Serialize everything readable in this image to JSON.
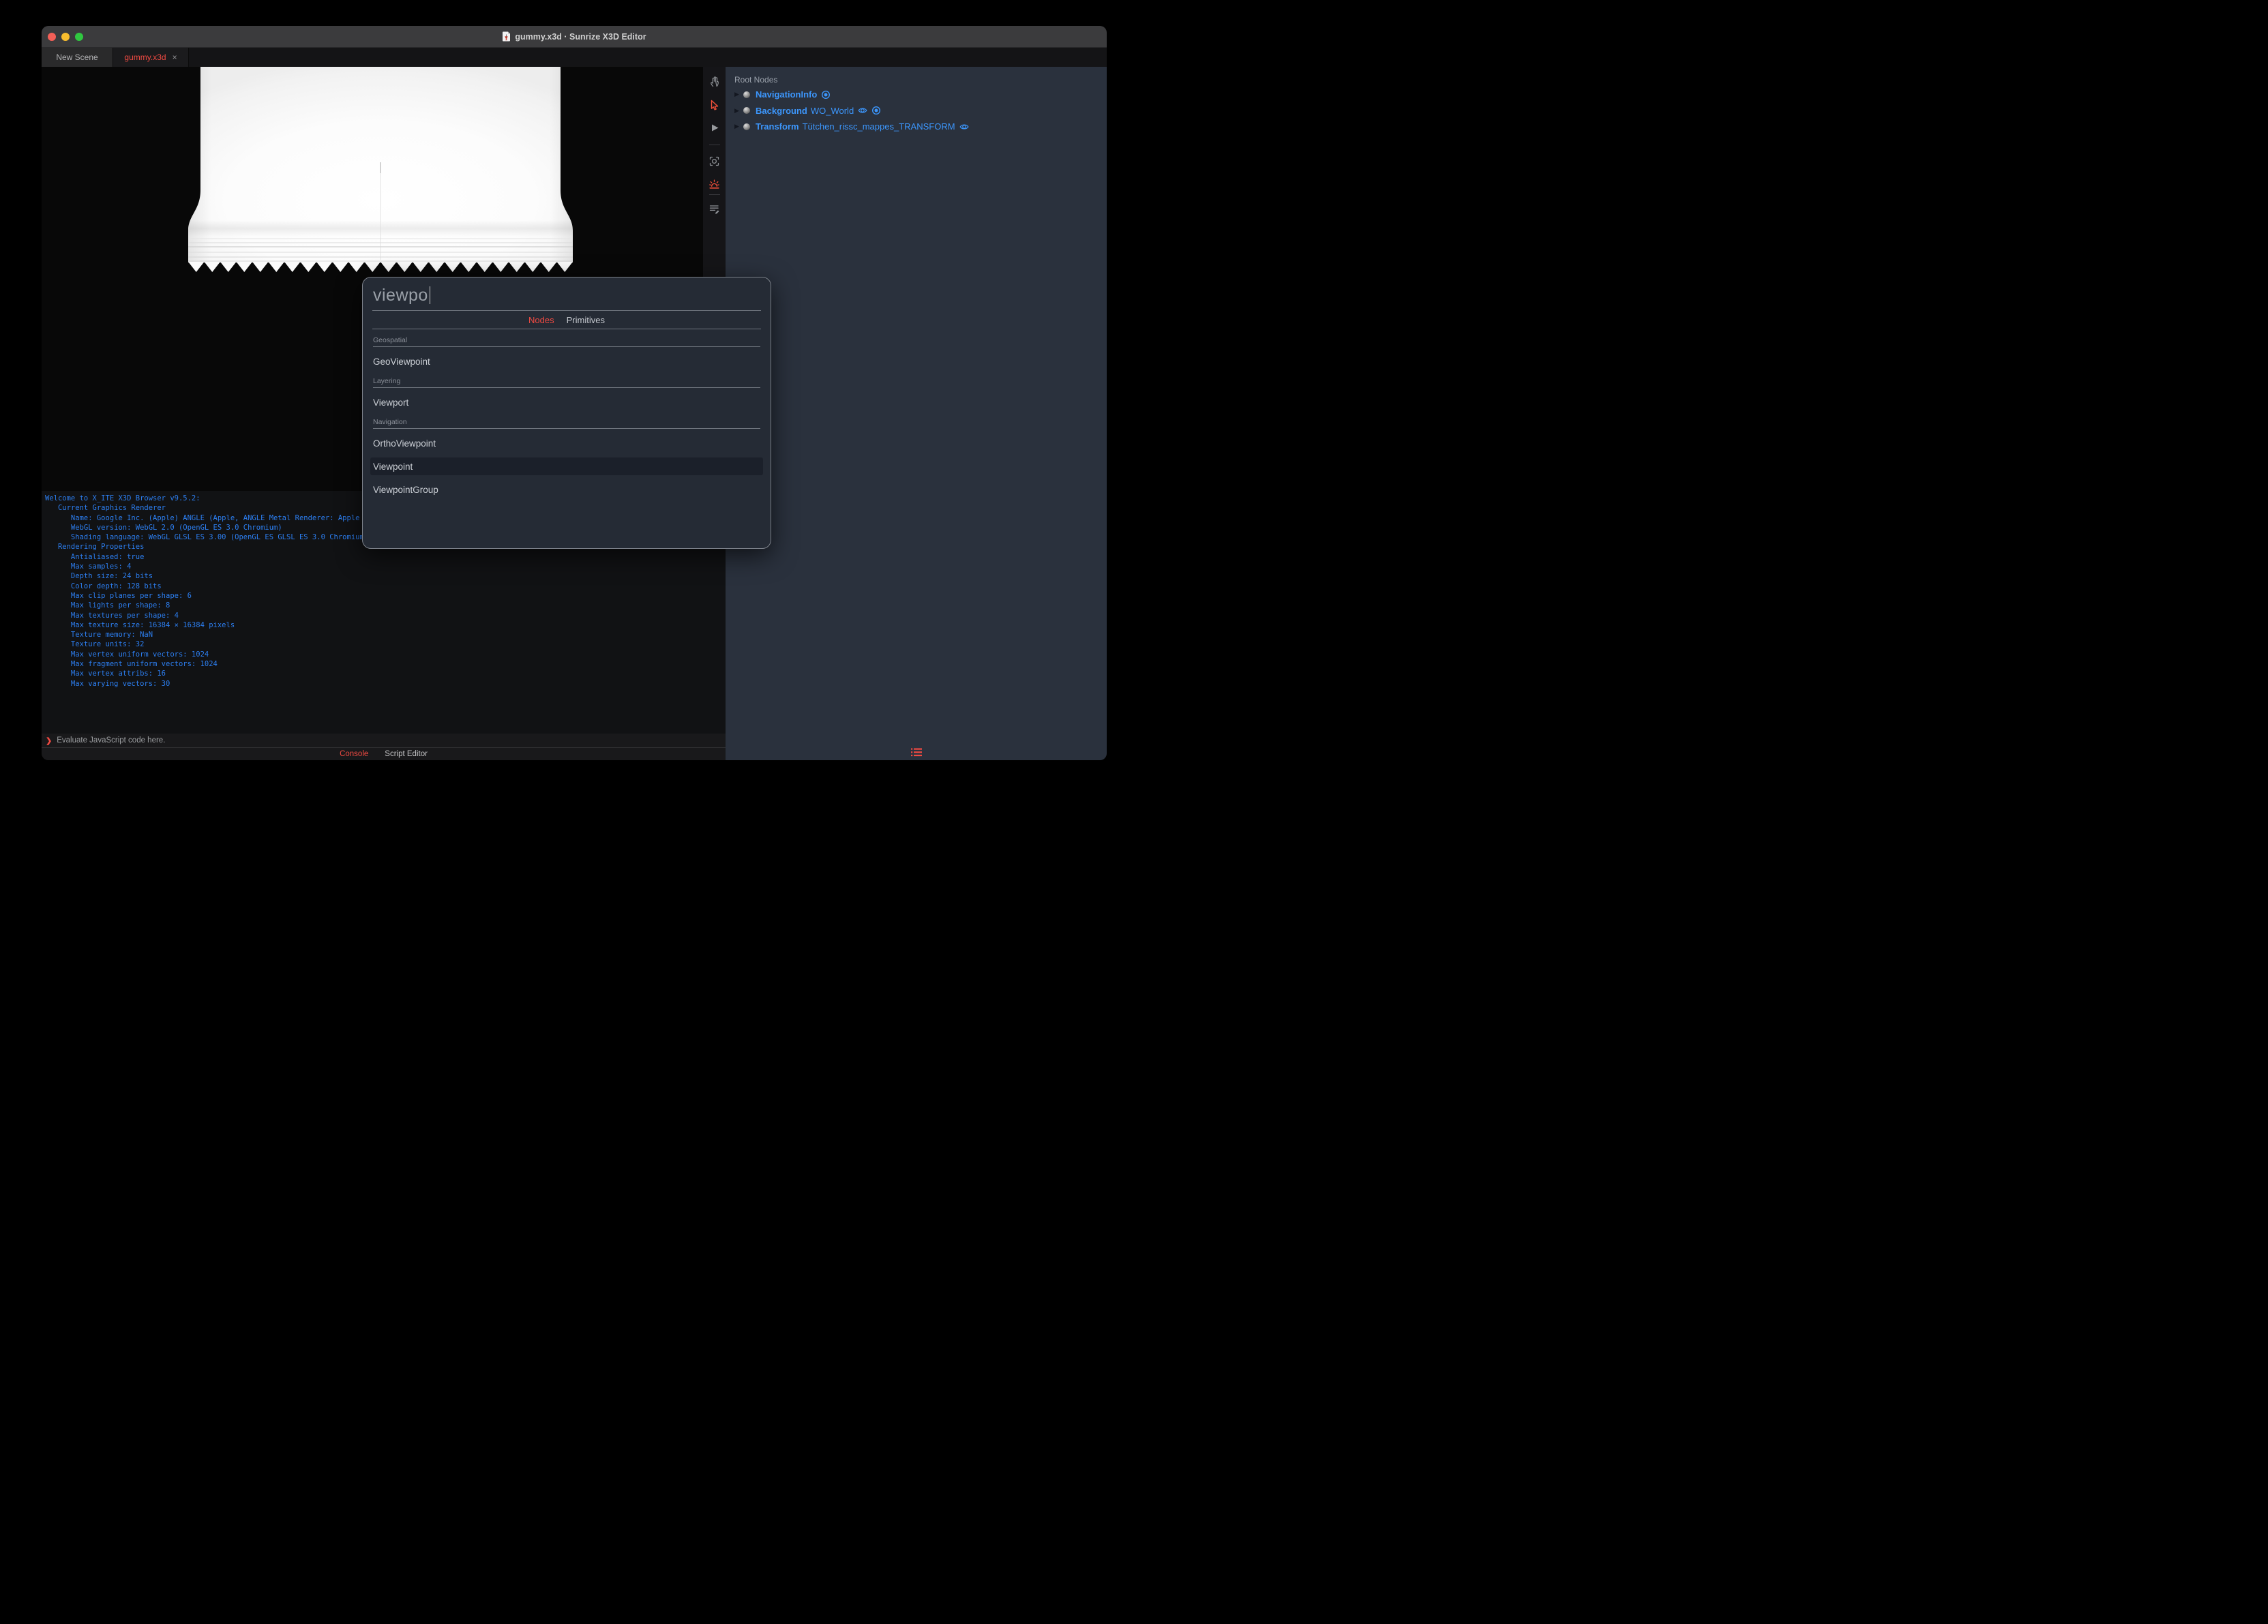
{
  "titlebar": {
    "title": "gummy.x3d · Sunrize X3D Editor"
  },
  "tabs": {
    "new_scene": {
      "label": "New Scene"
    },
    "document": {
      "label": "gummy.x3d",
      "close": "×",
      "active": true
    }
  },
  "toolbar": {
    "icons": [
      "pan-hand",
      "select-arrow",
      "play",
      "frame-view",
      "sunrise-light",
      "script-edit"
    ],
    "active_color": "#f2503a",
    "inactive_color": "#8d9095"
  },
  "outline": {
    "header": "Root Nodes",
    "expander": "▶",
    "nodes": [
      {
        "type": "NavigationInfo",
        "def": "",
        "icons": [
          "bind-target"
        ]
      },
      {
        "type": "Background",
        "def": "WO_World",
        "icons": [
          "visibility-eye",
          "bind-target"
        ]
      },
      {
        "type": "Transform",
        "def": "Tütchen_rissc_mappes_TRANSFORM",
        "icons": [
          "visibility-eye"
        ]
      }
    ],
    "node_color": "#3c96fc"
  },
  "dialog": {
    "query": "viewpo",
    "tabs": {
      "nodes": "Nodes",
      "primitives": "Primitives",
      "active": "Nodes"
    },
    "sections": [
      {
        "label": "Geospatial",
        "items": [
          {
            "label": "GeoViewpoint"
          }
        ]
      },
      {
        "label": "Layering",
        "items": [
          {
            "label": "Viewport"
          }
        ]
      },
      {
        "label": "Navigation",
        "items": [
          {
            "label": "OrthoViewpoint"
          },
          {
            "label": "Viewpoint",
            "selected": true
          },
          {
            "label": "ViewpointGroup"
          }
        ]
      }
    ]
  },
  "console": {
    "lines": [
      "Welcome to X_ITE X3D Browser v9.5.2:",
      "   Current Graphics Renderer",
      "      Name: Google Inc. (Apple) ANGLE (Apple, ANGLE Metal Renderer: Apple",
      "      WebGL version: WebGL 2.0 (OpenGL ES 3.0 Chromium)",
      "      Shading language: WebGL GLSL ES 3.00 (OpenGL ES GLSL ES 3.0 Chromium",
      "   Rendering Properties",
      "      Antialiased: true",
      "      Max samples: 4",
      "      Depth size: 24 bits",
      "      Color depth: 128 bits",
      "      Max clip planes per shape: 6",
      "      Max lights per shape: 8",
      "      Max textures per shape: 4",
      "      Max texture size: 16384 × 16384 pixels",
      "      Texture memory: NaN",
      "      Texture units: 32",
      "      Max vertex uniform vectors: 1024",
      "      Max fragment uniform vectors: 1024",
      "      Max vertex attribs: 16",
      "      Max varying vectors: 30"
    ],
    "prompt": "❯",
    "input_placeholder": "Evaluate JavaScript code here.",
    "tabs": {
      "console": "Console",
      "script_editor": "Script Editor",
      "active": "Console"
    }
  },
  "colors": {
    "accent_red": "#f14a42",
    "console_blue": "#2c7ef0",
    "node_blue": "#3c96fc",
    "panel_bg": "#2a313d",
    "dialog_bg": "#252b35",
    "titlebar_bg": "#3b3b3d",
    "traffic_lights": [
      "#f35f57",
      "#f8bd2e",
      "#30c740"
    ]
  }
}
